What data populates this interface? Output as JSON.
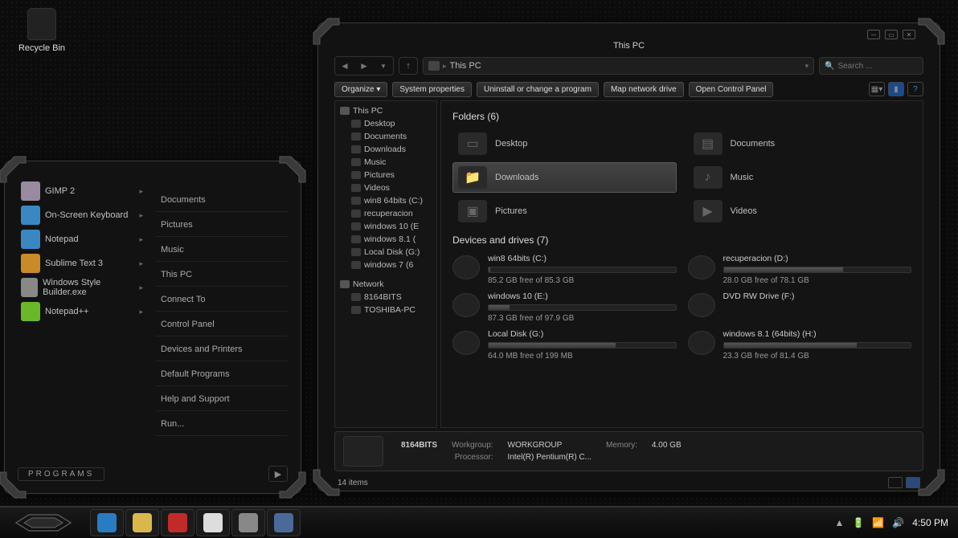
{
  "desktop": {
    "recycle_bin": "Recycle Bin"
  },
  "start_menu": {
    "programs_label": "PROGRAMS",
    "programs": [
      {
        "name": "GIMP 2",
        "color": "#9a8aa0"
      },
      {
        "name": "On-Screen Keyboard",
        "color": "#3a88c2"
      },
      {
        "name": "Notepad",
        "color": "#3a88c2"
      },
      {
        "name": "Sublime Text 3",
        "color": "#c98a2a"
      },
      {
        "name": "Windows Style Builder.exe",
        "color": "#888888"
      },
      {
        "name": "Notepad++",
        "color": "#6ab82a"
      }
    ],
    "links": [
      "Documents",
      "Pictures",
      "Music",
      "This PC",
      "Connect To",
      "Control Panel",
      "Devices and Printers",
      "Default Programs",
      "Help and Support",
      "Run..."
    ]
  },
  "explorer": {
    "title": "This PC",
    "address": "This PC",
    "search_placeholder": "Search ...",
    "toolbar": {
      "organize": "Organize ▾",
      "props": "System properties",
      "uninstall": "Uninstall or change a program",
      "map": "Map network drive",
      "cpanel": "Open Control Panel"
    },
    "tree": {
      "root": "This PC",
      "items": [
        "Desktop",
        "Documents",
        "Downloads",
        "Music",
        "Pictures",
        "Videos",
        "win8 64bits (C:)",
        "recuperacion",
        "windows 10 (E",
        "windows 8.1 (",
        "Local Disk (G:)",
        "windows 7 (6"
      ],
      "network_label": "Network",
      "network": [
        "8164BITS",
        "TOSHIBA-PC"
      ]
    },
    "sections": {
      "folders_h": "Folders (6)",
      "folders": [
        "Desktop",
        "Documents",
        "Downloads",
        "Music",
        "Pictures",
        "Videos"
      ],
      "drives_h": "Devices and drives (7)",
      "drives": [
        {
          "name": "win8 64bits (C:)",
          "free": "85.2 GB free of 85.3 GB",
          "pct": 1
        },
        {
          "name": "recuperacion (D:)",
          "free": "28.0 GB free of 78.1 GB",
          "pct": 64
        },
        {
          "name": "windows 10 (E:)",
          "free": "87.3 GB free of 97.9 GB",
          "pct": 11
        },
        {
          "name": "DVD RW Drive (F:)",
          "free": "",
          "pct": null
        },
        {
          "name": "Local Disk (G:)",
          "free": "64.0 MB free of 199 MB",
          "pct": 68
        },
        {
          "name": "windows 8.1 (64bits) (H:)",
          "free": "23.3 GB free of 81.4 GB",
          "pct": 71
        }
      ]
    },
    "status": {
      "pc": "8164BITS",
      "workgroup_l": "Workgroup:",
      "workgroup": "WORKGROUP",
      "processor_l": "Processor:",
      "processor": "Intel(R) Pentium(R) C...",
      "memory_l": "Memory:",
      "memory": "4.00 GB"
    },
    "footer": {
      "count": "14 items"
    }
  },
  "taskbar": {
    "clock": "4:50 PM",
    "pins": [
      {
        "color": "#2a7cc2"
      },
      {
        "color": "#d8b84a"
      },
      {
        "color": "#c22a2a"
      },
      {
        "color": "#ddd"
      },
      {
        "color": "#888"
      },
      {
        "color": "#4a6a9a"
      }
    ]
  }
}
